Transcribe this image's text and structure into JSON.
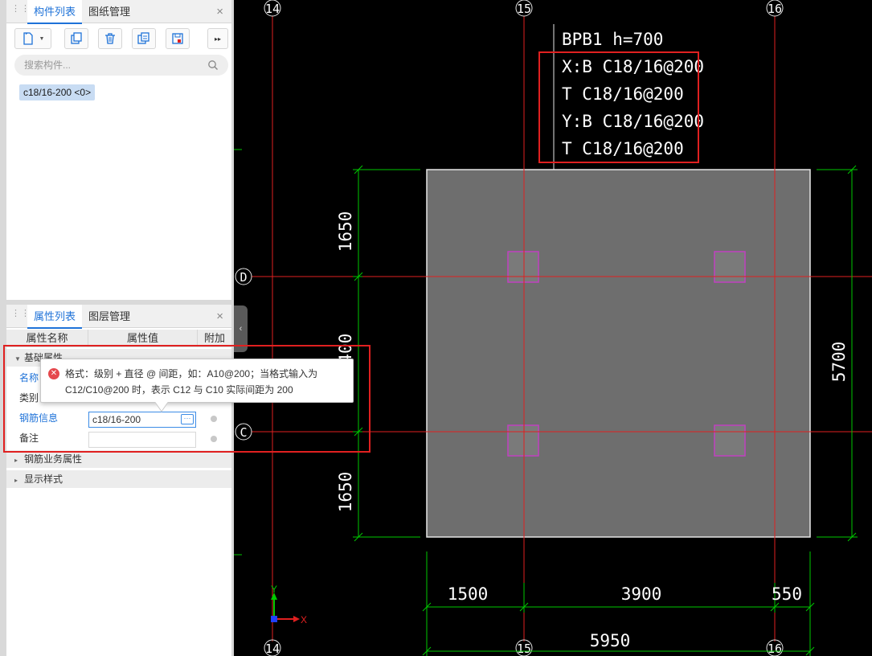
{
  "component_panel": {
    "tabs": [
      {
        "label": "构件列表",
        "active": true
      },
      {
        "label": "图纸管理",
        "active": false
      }
    ],
    "close": "×",
    "toolbar": [
      {
        "icon": "new-component-icon"
      },
      {
        "icon": "dropdown-arrow-icon"
      },
      {
        "icon": "copy-icon"
      },
      {
        "icon": "delete-icon"
      },
      {
        "icon": "layer-copy-icon"
      },
      {
        "icon": "save-icon"
      },
      {
        "icon": "more-icon"
      }
    ],
    "search_placeholder": "搜索构件...",
    "items": [
      "c18/16-200 <0>"
    ]
  },
  "property_panel": {
    "tabs": [
      {
        "label": "属性列表",
        "active": true
      },
      {
        "label": "图层管理",
        "active": false
      }
    ],
    "close": "×",
    "columns": [
      "属性名称",
      "属性值",
      "附加"
    ],
    "sections": [
      {
        "label": "基础属性",
        "expanded": true
      },
      {
        "label": "钢筋业务属性",
        "expanded": false
      },
      {
        "label": "显示样式",
        "expanded": false
      }
    ],
    "rows": [
      {
        "name": "名称",
        "value": "",
        "highlight": true
      },
      {
        "name": "类别",
        "value": "",
        "highlight": false
      },
      {
        "name": "钢筋信息",
        "value": "c18/16-200",
        "highlight": true
      },
      {
        "name": "备注",
        "value": "",
        "highlight": false
      }
    ],
    "more_button": "···"
  },
  "tooltip": {
    "line1": "格式：级别 + 直径 @ 间距，如：A10@200；当格式输入为",
    "line2": "C12/C10@200 时，表示 C12 与 C10 实际间距为 200",
    "icon": "error-icon"
  },
  "splitter": {
    "icon": "collapse-left-icon",
    "glyph": "‹"
  },
  "cad": {
    "axis_labels": {
      "top": [
        "14",
        "15",
        "16"
      ],
      "bottom": [
        "14",
        "15",
        "16"
      ],
      "left": [
        "D",
        "C"
      ]
    },
    "annotation": {
      "title": "BPB1 h=700",
      "lines": [
        "X:B  C18/16@200",
        "T     C18/16@200",
        "Y:B  C18/16@200",
        "T     C18/16@200"
      ]
    },
    "dims": {
      "left_top": "1650",
      "left_mid": "2400",
      "left_bottom": "1650",
      "right": "5700",
      "bottom_1": "1500",
      "bottom_2": "3900",
      "bottom_3": "550",
      "bottom_total": "5950"
    },
    "ucs": {
      "x": "X",
      "y": "Y"
    },
    "colors": {
      "grid": "#e02020",
      "dim": "#00c800",
      "slab": "#6e6e6e",
      "column": "#c040c0",
      "annot_box": "#e02020"
    }
  }
}
